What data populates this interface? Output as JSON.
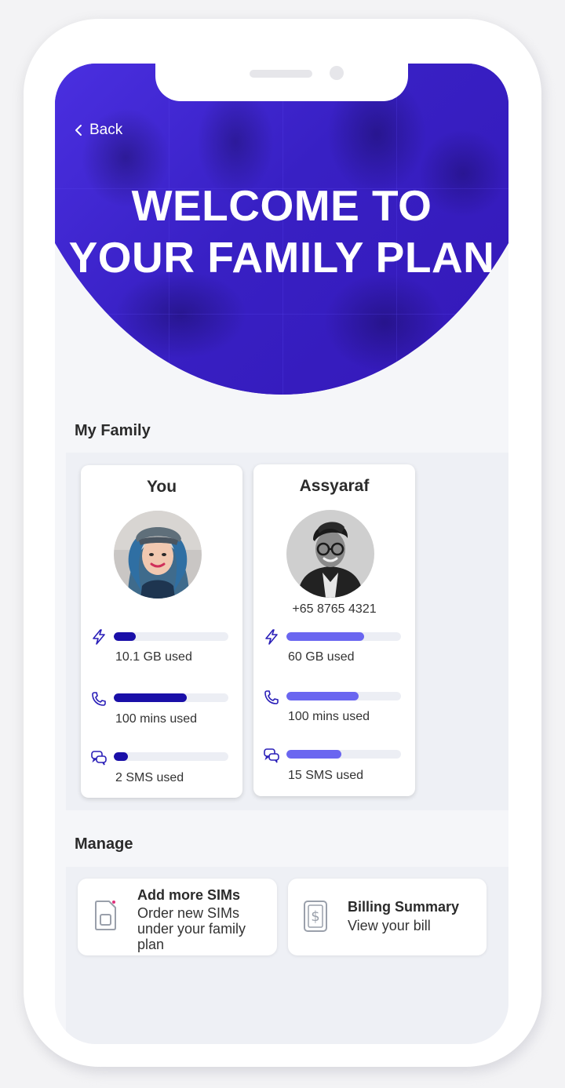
{
  "hero": {
    "back_label": "Back",
    "title_line1": "WELCOME TO",
    "title_line2": "YOUR FAMILY PLAN"
  },
  "family": {
    "section_title": "My Family",
    "members": [
      {
        "name": "You",
        "phone": "",
        "data_used": "10.1 GB used",
        "data_fraction": 0.19,
        "mins_used": "100 mins used",
        "mins_fraction": 0.64,
        "sms_used": "2 SMS used",
        "sms_fraction": 0.12,
        "bar_color": "#1a0fa8"
      },
      {
        "name": "Assyaraf",
        "phone": "+65 8765 4321",
        "data_used": "60 GB used",
        "data_fraction": 0.68,
        "mins_used": "100 mins used",
        "mins_fraction": 0.63,
        "sms_used": "15 SMS used",
        "sms_fraction": 0.48,
        "bar_color": "#6a66f0"
      }
    ]
  },
  "manage": {
    "section_title": "Manage",
    "items": [
      {
        "title": "Add more SIMs",
        "subtitle_line1": "Order new SIMs",
        "subtitle_line2": "under your family",
        "subtitle_line3": "plan",
        "icon": "sim-card-icon"
      },
      {
        "title": "Billing Summary",
        "subtitle_line1": "View your bill",
        "icon": "bill-icon"
      }
    ]
  },
  "colors": {
    "hero": "#3a22c9",
    "icon": "#2a1fb8",
    "accent_pink": "#e0307a"
  }
}
